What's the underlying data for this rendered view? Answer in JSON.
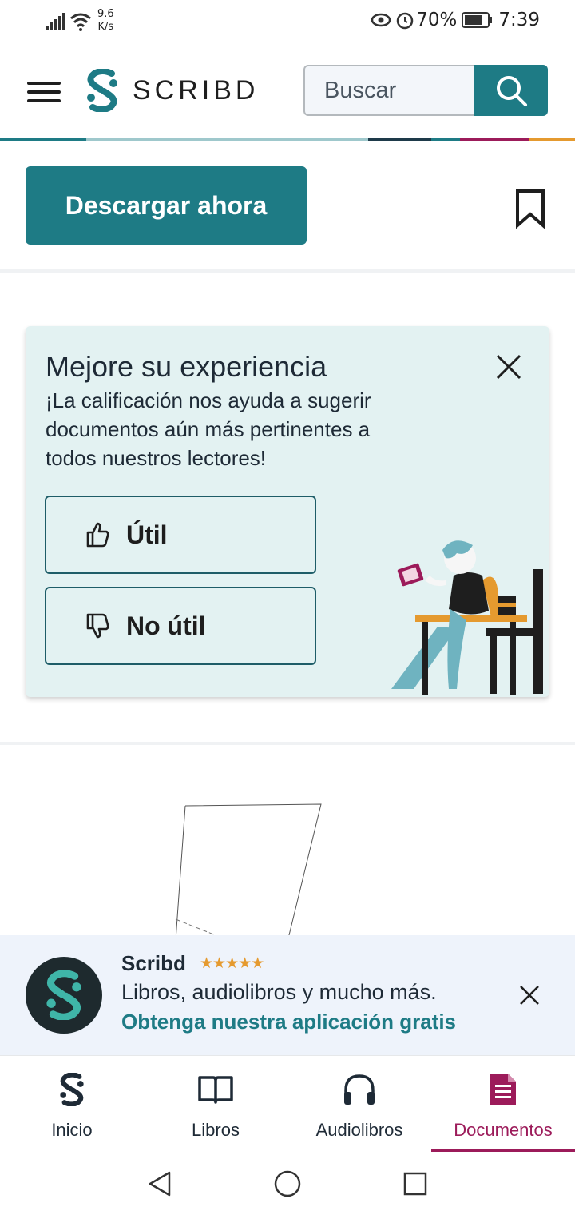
{
  "status_bar": {
    "net_speed_value": "9.6",
    "net_speed_unit": "K/s",
    "battery": "70%",
    "time": "7:39"
  },
  "header": {
    "logo_text": "SCRIBD",
    "search_placeholder": "Buscar"
  },
  "actions": {
    "download_label": "Descargar ahora"
  },
  "rating_card": {
    "title": "Mejore su experiencia",
    "description": "¡La calificación nos ayuda a sugerir documentos aún más pertinentes a todos nuestros lectores!",
    "useful_label": "Útil",
    "not_useful_label": "No útil"
  },
  "app_banner": {
    "app_name": "Scribd",
    "rating_stars": "★★★★★",
    "description": "Libros, audiolibros y mucho más.",
    "cta": "Obtenga nuestra aplicación gratis"
  },
  "bottom_nav": {
    "items": [
      {
        "label": "Inicio",
        "icon": "scribd-home-icon"
      },
      {
        "label": "Libros",
        "icon": "book-icon"
      },
      {
        "label": "Audiolibros",
        "icon": "headphones-icon"
      },
      {
        "label": "Documentos",
        "icon": "document-icon",
        "active": true
      }
    ]
  },
  "colors": {
    "brand_teal": "#1e7b85",
    "active_magenta": "#9c1b5a",
    "card_bg": "#e3f2f2",
    "star_orange": "#e59a2f"
  }
}
